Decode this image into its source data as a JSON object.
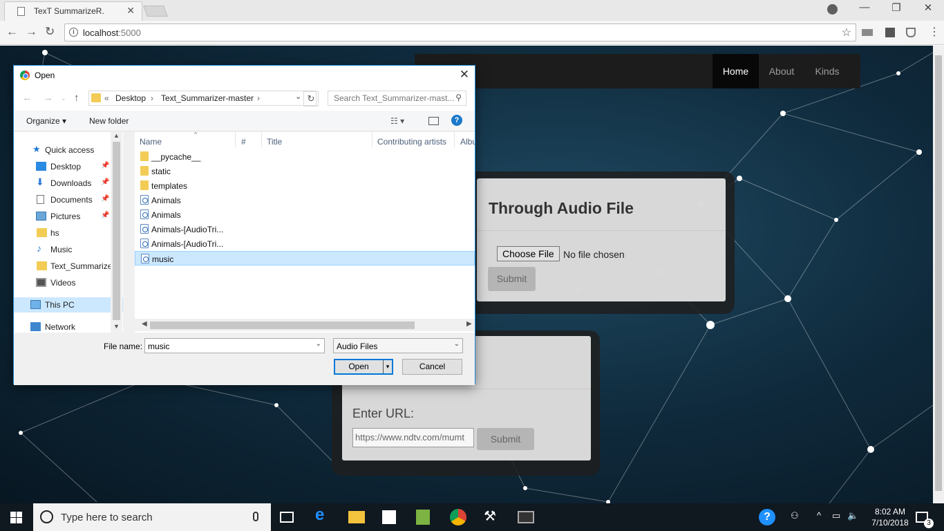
{
  "browser": {
    "tab_title": "TexT SummarizeR.",
    "url_host": "localhost",
    "url_port": ":5000"
  },
  "site": {
    "nav": [
      "Home",
      "About",
      "Kinds"
    ],
    "audio_card": {
      "heading": "Through Audio File",
      "choose_label": "Choose File",
      "no_file": "No file chosen",
      "submit": "Submit"
    },
    "url_card": {
      "label": "Enter URL:",
      "value": "https://www.ndtv.com/mumt",
      "submit": "Submit"
    }
  },
  "dialog": {
    "title": "Open",
    "breadcrumb": [
      "«",
      "Desktop",
      "›",
      "Text_Summarizer-master",
      "›"
    ],
    "search_placeholder": "Search Text_Summarizer-mast...",
    "organize": "Organize",
    "new_folder": "New folder",
    "nav_items": [
      {
        "label": "Quick access",
        "icon": "star-icon"
      },
      {
        "label": "Desktop",
        "icon": "desktop-icon",
        "pinned": true
      },
      {
        "label": "Downloads",
        "icon": "download-icon",
        "pinned": true
      },
      {
        "label": "Documents",
        "icon": "documents-icon",
        "pinned": true
      },
      {
        "label": "Pictures",
        "icon": "pictures-icon",
        "pinned": true
      },
      {
        "label": "hs",
        "icon": "folder-icon"
      },
      {
        "label": "Music",
        "icon": "music-icon"
      },
      {
        "label": "Text_Summarize",
        "icon": "folder-icon"
      },
      {
        "label": "Videos",
        "icon": "videos-icon"
      },
      {
        "label": "This PC",
        "icon": "pc-icon",
        "selected": true
      },
      {
        "label": "Network",
        "icon": "network-icon"
      }
    ],
    "columns": [
      "Name",
      "#",
      "Title",
      "Contributing artists",
      "Albu"
    ],
    "files": [
      {
        "name": "__pycache__",
        "type": "folder"
      },
      {
        "name": "static",
        "type": "folder"
      },
      {
        "name": "templates",
        "type": "folder"
      },
      {
        "name": "Animals",
        "type": "audio"
      },
      {
        "name": "Animals",
        "type": "audio"
      },
      {
        "name": "Animals-[AudioTri...",
        "type": "audio"
      },
      {
        "name": "Animals-[AudioTri...",
        "type": "audio"
      },
      {
        "name": "music",
        "type": "audio",
        "selected": true
      }
    ],
    "file_name_label": "File name:",
    "file_name_value": "music",
    "file_type": "Audio Files",
    "open": "Open",
    "cancel": "Cancel"
  },
  "taskbar": {
    "search_placeholder": "Type here to search",
    "time": "8:02 AM",
    "date": "7/10/2018",
    "notifications": "3"
  }
}
